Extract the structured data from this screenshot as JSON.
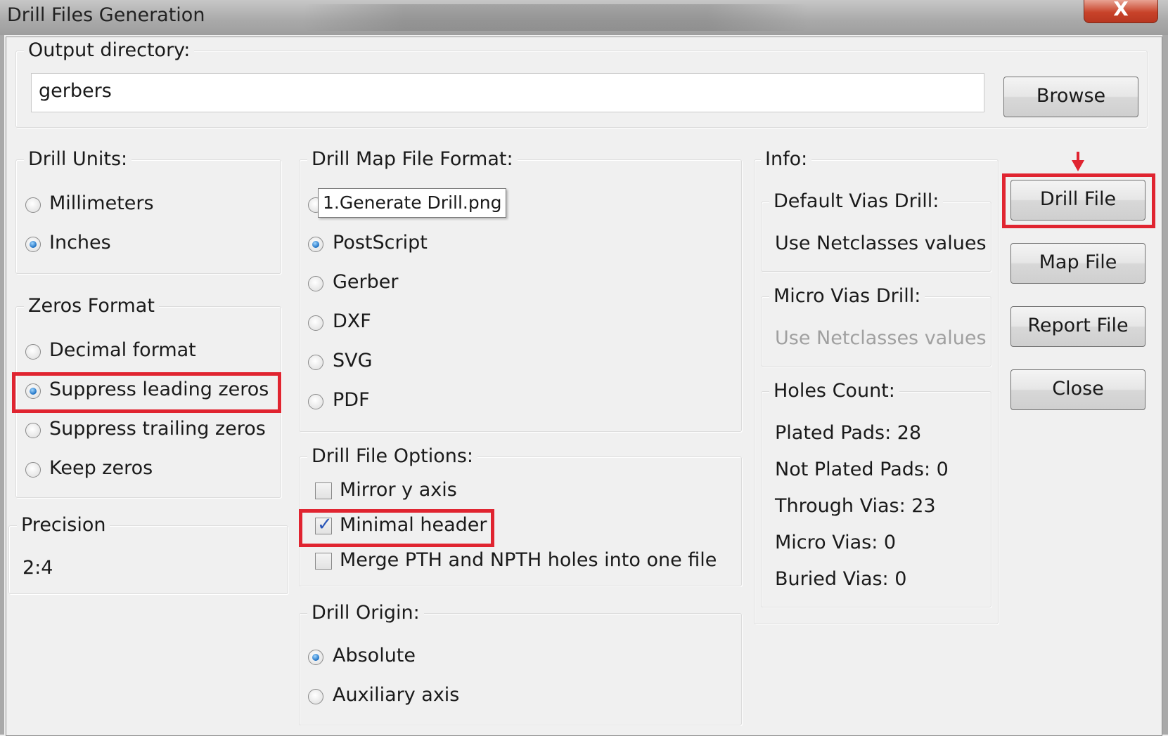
{
  "window": {
    "title": "Drill Files Generation",
    "close_glyph": "X"
  },
  "output": {
    "label": "Output directory:",
    "value": "gerbers",
    "browse_label": "Browse"
  },
  "drill_units": {
    "title": "Drill Units:",
    "options": [
      {
        "label": "Millimeters",
        "checked": false
      },
      {
        "label": "Inches",
        "checked": true
      }
    ]
  },
  "zeros_format": {
    "title": "Zeros Format",
    "options": [
      {
        "label": "Decimal format",
        "checked": false
      },
      {
        "label": "Suppress leading zeros",
        "checked": true
      },
      {
        "label": "Suppress trailing zeros",
        "checked": false
      },
      {
        "label": "Keep zeros",
        "checked": false
      }
    ]
  },
  "precision": {
    "title": "Precision",
    "value": "2:4"
  },
  "map_format": {
    "title": "Drill Map File Format:",
    "options": [
      {
        "label": "PostScript",
        "checked": true
      },
      {
        "label": "Gerber",
        "checked": false
      },
      {
        "label": "DXF",
        "checked": false
      },
      {
        "label": "SVG",
        "checked": false
      },
      {
        "label": "PDF",
        "checked": false
      }
    ]
  },
  "tooltip": {
    "text": "1.Generate Drill.png"
  },
  "drill_options": {
    "title": "Drill File Options:",
    "items": [
      {
        "label": "Mirror y axis",
        "checked": false
      },
      {
        "label": "Minimal header",
        "checked": true
      },
      {
        "label": "Merge PTH and NPTH holes into one file",
        "checked": false
      }
    ]
  },
  "drill_origin": {
    "title": "Drill Origin:",
    "options": [
      {
        "label": "Absolute",
        "checked": true
      },
      {
        "label": "Auxiliary axis",
        "checked": false
      }
    ]
  },
  "info": {
    "title": "Info:",
    "default_vias": {
      "title": "Default Vias Drill:",
      "value": "Use Netclasses values"
    },
    "micro_vias": {
      "title": "Micro Vias Drill:",
      "value": "Use Netclasses values"
    },
    "holes": {
      "title": "Holes Count:",
      "lines": [
        "Plated Pads: 28",
        "Not Plated Pads: 0",
        "Through Vias: 23",
        "Micro Vias: 0",
        "Buried Vias: 0"
      ]
    }
  },
  "buttons": {
    "drill_file": "Drill File",
    "map_file": "Map File",
    "report_file": "Report File",
    "close": "Close"
  },
  "colors": {
    "highlight": "#e02430",
    "radio_dot": "#1c6fc2"
  }
}
